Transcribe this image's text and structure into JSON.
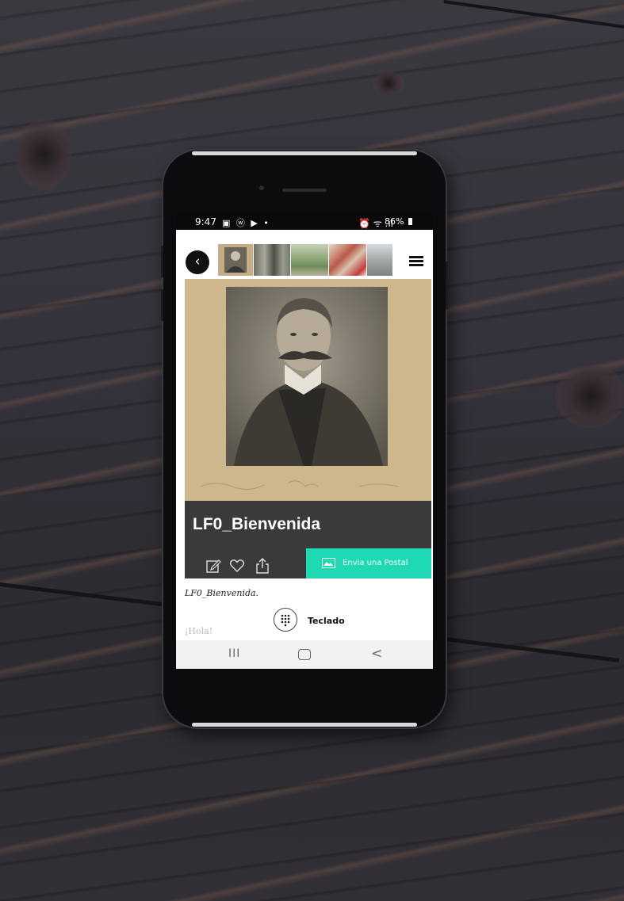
{
  "status_bar": {
    "time": "9:47",
    "left_icons": "▣ ⓦ ▶ •",
    "right_icons": "⏰ ᯤ .ıl",
    "battery": "86%"
  },
  "header": {
    "back_glyph": "‹",
    "thumbnails": [
      "portrait",
      "interior",
      "garden",
      "room",
      "building"
    ]
  },
  "content": {
    "title": "LF0_Bienvenida",
    "description": "LF0_Bienvenida.",
    "greeting": "¡Hola!",
    "postal_button": "Envia una Postal",
    "keypad_label": "Teclado"
  },
  "nav": {
    "recent": "III",
    "back": "<"
  },
  "colors": {
    "accent": "#1fd9b3",
    "info_bar": "#3a3a3a"
  }
}
